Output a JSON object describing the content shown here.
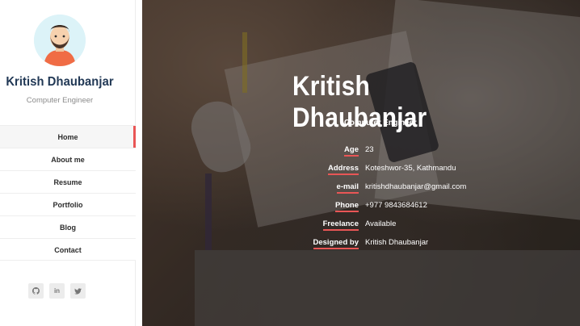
{
  "profile": {
    "name": "Kritish Dhaubanjar",
    "role": "Computer Engineer"
  },
  "nav": {
    "items": [
      {
        "label": "Home",
        "active": true
      },
      {
        "label": "About me",
        "active": false
      },
      {
        "label": "Resume",
        "active": false
      },
      {
        "label": "Portfolio",
        "active": false
      },
      {
        "label": "Blog",
        "active": false
      },
      {
        "label": "Contact",
        "active": false
      }
    ]
  },
  "socials": [
    {
      "icon": "github-icon"
    },
    {
      "icon": "linkedin-icon",
      "glyph": "in"
    },
    {
      "icon": "twitter-icon"
    }
  ],
  "hero": {
    "title": "Kritish Dhaubanjar",
    "subtitle": "Computer Engineer",
    "details": [
      {
        "label": "Age",
        "value": "23"
      },
      {
        "label": "Address",
        "value": "Koteshwor-35, Kathmandu"
      },
      {
        "label": "e-mail",
        "value": "kritishdhaubanjar@gmail.com"
      },
      {
        "label": "Phone",
        "value": "+977 9843684612"
      },
      {
        "label": "Freelance",
        "value": "Available"
      },
      {
        "label": "Designed by",
        "value": "Kritish Dhaubanjar"
      }
    ]
  },
  "colors": {
    "accent": "#e95656",
    "name": "#213855"
  }
}
